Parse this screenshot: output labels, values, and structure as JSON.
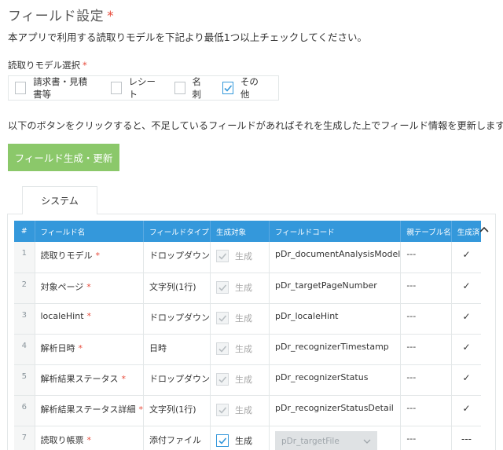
{
  "header": {
    "title": "フィールド設定",
    "required_mark": "*",
    "intro": "本アプリで利用する読取りモデルを下記より最低1つ以上チェックしてください。"
  },
  "model_selection": {
    "label": "読取りモデル選択",
    "required_mark": "*",
    "options": [
      {
        "label": "請求書・見積書等",
        "checked": false
      },
      {
        "label": "レシート",
        "checked": false
      },
      {
        "label": "名刺",
        "checked": false
      },
      {
        "label": "その他",
        "checked": true
      }
    ]
  },
  "notice": "以下のボタンをクリックすると、不足しているフィールドがあればそれを生成した上でフィールド情報を更新します。",
  "generate_button": "フィールド生成・更新",
  "tabs": [
    {
      "label": "システム",
      "active": true
    }
  ],
  "table": {
    "headers": [
      "#",
      "フィールド名",
      "フィールドタイプ",
      "生成対象",
      "フィールドコード",
      "親テーブル名",
      "生成済"
    ],
    "generate_label": "生成",
    "rows": [
      {
        "num": "1",
        "name": "読取りモデル",
        "required": "*",
        "type": "ドロップダウン",
        "gen_checked": true,
        "gen_disabled": true,
        "code": "pDr_documentAnalysisModel",
        "parent": "---",
        "done": "✓"
      },
      {
        "num": "2",
        "name": "対象ページ",
        "required": "*",
        "type": "文字列(1行)",
        "gen_checked": true,
        "gen_disabled": true,
        "code": "pDr_targetPageNumber",
        "parent": "---",
        "done": "✓"
      },
      {
        "num": "3",
        "name": "localeHint",
        "required": "*",
        "type": "ドロップダウン",
        "gen_checked": true,
        "gen_disabled": true,
        "code": "pDr_localeHint",
        "parent": "---",
        "done": "✓"
      },
      {
        "num": "4",
        "name": "解析日時",
        "required": "*",
        "type": "日時",
        "gen_checked": true,
        "gen_disabled": true,
        "code": "pDr_recognizerTimestamp",
        "parent": "---",
        "done": "✓"
      },
      {
        "num": "5",
        "name": "解析結果ステータス",
        "required": "*",
        "type": "ドロップダウン",
        "gen_checked": true,
        "gen_disabled": true,
        "code": "pDr_recognizerStatus",
        "parent": "---",
        "done": "✓"
      },
      {
        "num": "6",
        "name": "解析結果ステータス詳細",
        "required": "*",
        "type": "文字列(1行)",
        "gen_checked": true,
        "gen_disabled": true,
        "code": "pDr_recognizerStatusDetail",
        "parent": "---",
        "done": "✓"
      },
      {
        "num": "7",
        "name": "読取り帳票",
        "required": "*",
        "type": "添付ファイル",
        "gen_checked": true,
        "gen_disabled": false,
        "code": "pDr_targetFile",
        "code_is_select": true,
        "parent": "---",
        "done": "---"
      }
    ]
  },
  "colors": {
    "accent_blue": "#3498db",
    "button_green": "#8bc86a",
    "required_red": "#e74c3c"
  },
  "icons": {
    "collapse": "chevron-up-icon",
    "select_arrow": "chevron-down-icon",
    "checkbox_check": "check-icon"
  }
}
